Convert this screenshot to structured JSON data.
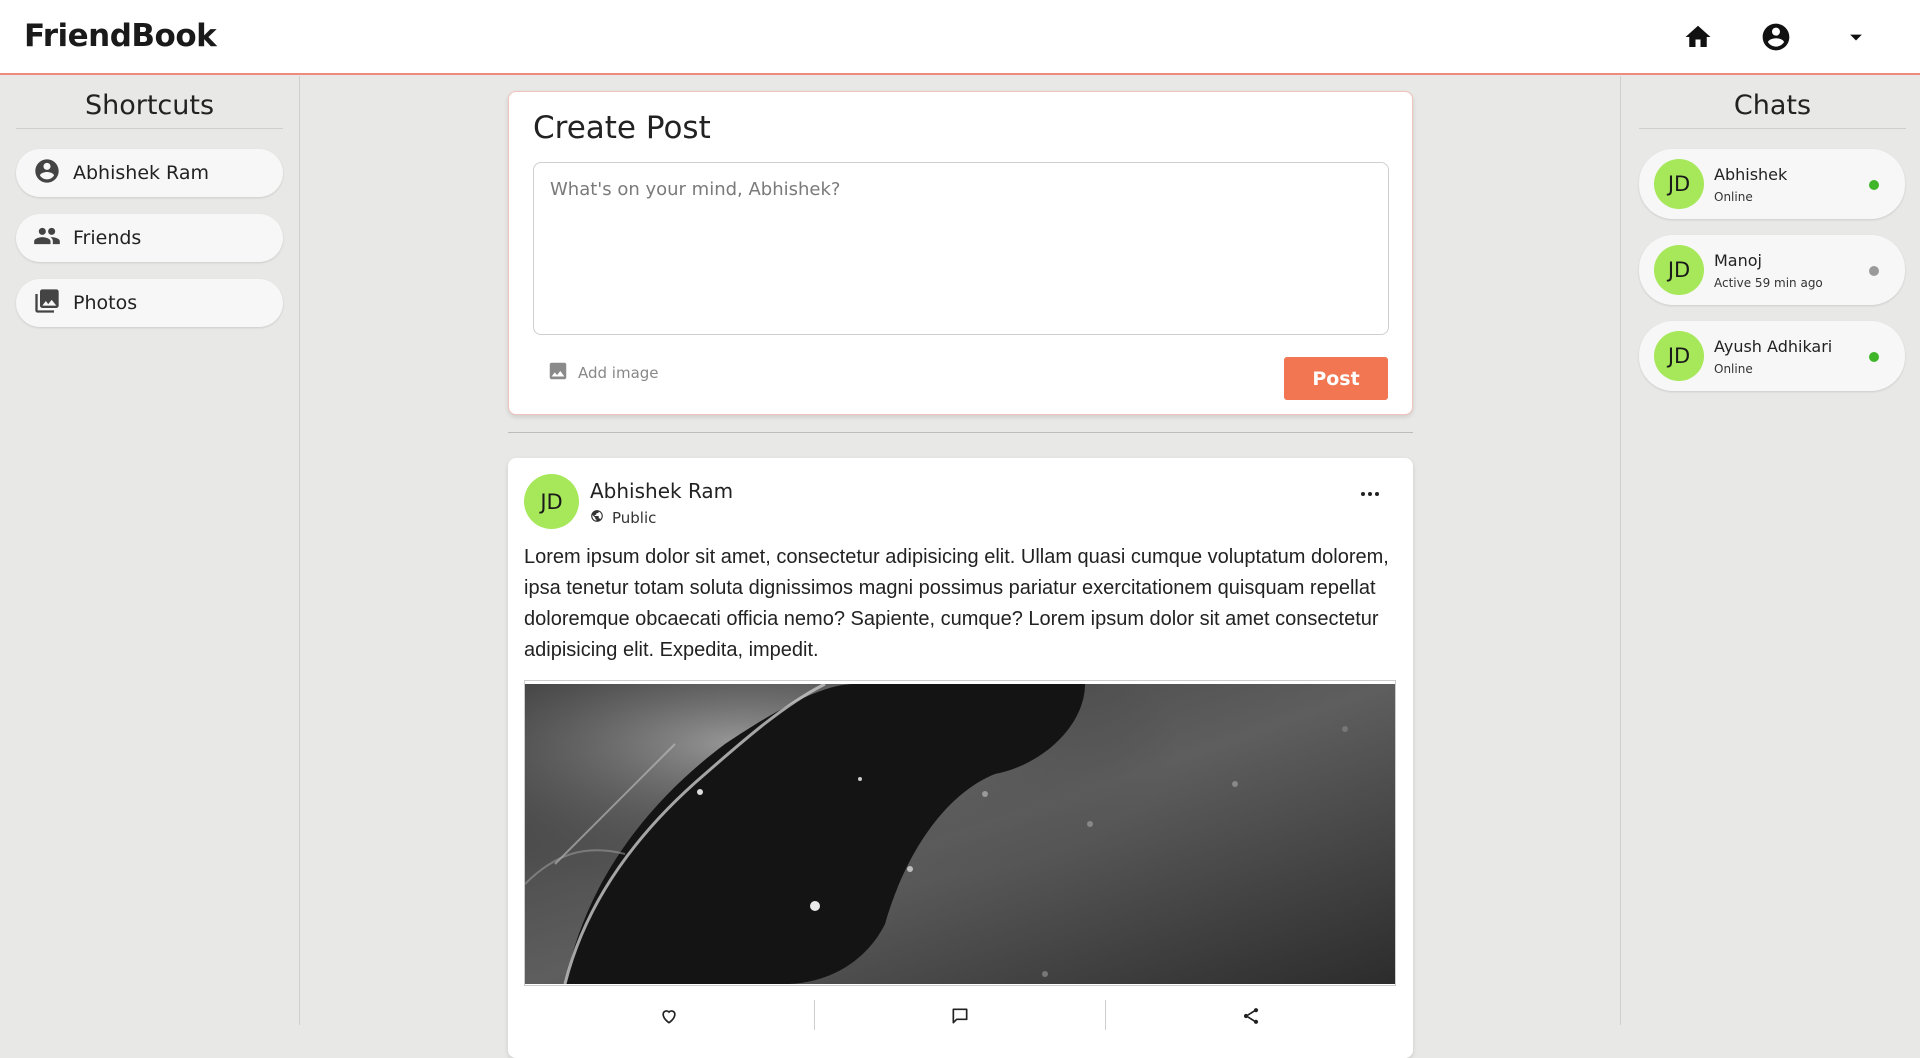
{
  "app": {
    "brand": "FriendBook"
  },
  "topnav": {
    "icons": [
      "home-icon",
      "account-circle-icon",
      "dropdown-caret-icon"
    ]
  },
  "shortcuts": {
    "title": "Shortcuts",
    "items": [
      {
        "label": "Abhishek Ram",
        "icon": "account-circle-icon"
      },
      {
        "label": "Friends",
        "icon": "people-icon"
      },
      {
        "label": "Photos",
        "icon": "photo-library-icon"
      }
    ]
  },
  "create_post": {
    "title": "Create Post",
    "placeholder": "What's on your mind, Abhishek?",
    "add_image_label": "Add image",
    "post_label": "Post"
  },
  "post": {
    "avatar_initials": "JD",
    "author": "Abhishek Ram",
    "visibility": "Public",
    "text": "Lorem ipsum dolor sit amet, consectetur adipisicing elit. Ullam quasi cumque voluptatum dolorem, ipsa tenetur totam soluta dignissimos magni possimus pariatur exercitationem quisquam repellat doloremque obcaecati officia nemo? Sapiente, cumque? Lorem ipsum dolor sit amet consectetur adipisicing elit. Expedita, impedit.",
    "actions": [
      "heart-icon",
      "comment-icon",
      "share-icon"
    ]
  },
  "chats": {
    "title": "Chats",
    "items": [
      {
        "initials": "JD",
        "name": "Abhishek",
        "status": "Online",
        "online": true
      },
      {
        "initials": "JD",
        "name": "Manoj",
        "status": "Active 59 min ago",
        "online": false
      },
      {
        "initials": "JD",
        "name": "Ayush Adhikari",
        "status": "Online",
        "online": true
      }
    ]
  },
  "colors": {
    "accent": "#f27652",
    "avatar": "#a6e85a",
    "online": "#3fb52a",
    "offline": "#9a9a9a",
    "background": "#e8e8e6",
    "header_border": "#f08a7e"
  }
}
